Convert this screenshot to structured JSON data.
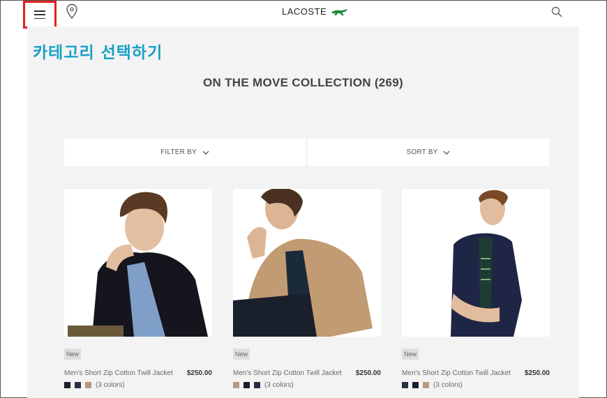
{
  "header": {
    "logo_text": "LACOSTE",
    "menu_icon": "hamburger-menu-icon",
    "store_icon": "location-pin-icon",
    "search_icon": "search-icon"
  },
  "annotation": {
    "text": "카테고리 선택하기",
    "color": "#19a0c6",
    "highlight_color": "#e02020"
  },
  "collection": {
    "title": "ON THE MOVE COLLECTION (269)"
  },
  "controls": {
    "filter_label": "FILTER BY",
    "sort_label": "SORT BY"
  },
  "products": [
    {
      "badge": "New",
      "name": "Men's Short Zip Cotton Twill Jacket",
      "price": "$250.00",
      "colors_label": "(3 colors)",
      "swatches": [
        "#1b1d2a",
        "#283048",
        "#b49a80"
      ],
      "jacket_color": "#15151d",
      "inner_color": "#7f9fc9"
    },
    {
      "badge": "New",
      "name": "Men's Short Zip Cotton Twill Jacket",
      "price": "$250.00",
      "colors_label": "(3 colors)",
      "swatches": [
        "#b49a80",
        "#1b1d2a",
        "#283048"
      ],
      "jacket_color": "#c19b71",
      "inner_color": "#1b2a3a"
    },
    {
      "badge": "New",
      "name": "Men's Short Zip Cotton Twill Jacket",
      "price": "$250.00",
      "colors_label": "(3 colors)",
      "swatches": [
        "#283048",
        "#1b1d2a",
        "#b49a80"
      ],
      "jacket_color": "#1f2645",
      "inner_color": "#1e3b34"
    }
  ],
  "colors": {
    "background": "#f3f3f3",
    "accent": "#19a0c6"
  }
}
